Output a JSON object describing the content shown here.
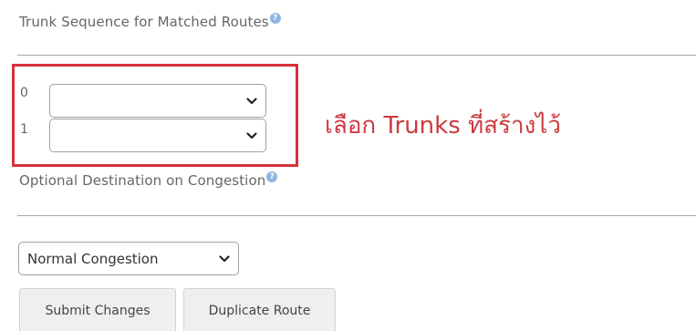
{
  "trunk_section": {
    "label": "Trunk Sequence for Matched Routes",
    "help_icon": "?",
    "rows": [
      {
        "index": "0",
        "value": ""
      },
      {
        "index": "1",
        "value": ""
      }
    ]
  },
  "annotation": {
    "text": "เลือก Trunks ที่สร้างไว้",
    "color": "#cd3a3f",
    "box_color": "#d6303a"
  },
  "congestion_section": {
    "label": "Optional Destination on Congestion",
    "help_icon": "?",
    "select_value": "Normal Congestion"
  },
  "buttons": {
    "submit_label": "Submit Changes",
    "duplicate_label": "Duplicate Route"
  },
  "icons": {
    "help": "help-circle-icon",
    "dropdown": "chevron-down-icon"
  }
}
